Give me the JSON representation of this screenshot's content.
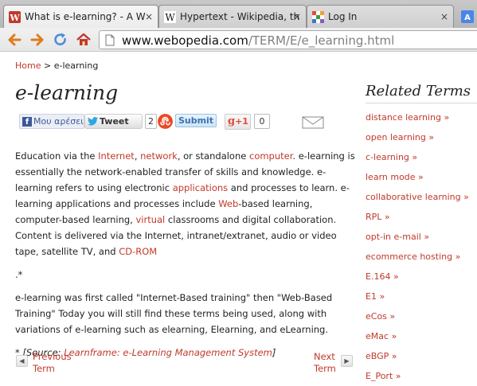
{
  "browser": {
    "tabs": [
      {
        "title": "What is e-learning? - A W",
        "icon": "webopedia-favicon",
        "active": true
      },
      {
        "title": "Hypertext - Wikipedia, th",
        "icon": "wikipedia-favicon",
        "active": false
      },
      {
        "title": "Log In",
        "icon": "login-favicon",
        "active": false
      }
    ],
    "close_glyph": "×",
    "url_host": "www.webopedia.com",
    "url_path": "/TERM/E/e_learning.html"
  },
  "breadcrumb": {
    "home": "Home",
    "separator": " > ",
    "current": "e-learning"
  },
  "page_title": "e-learning",
  "social": {
    "facebook_label": "Μου αρέσει",
    "tweet_label": "Tweet",
    "tweet_count": "2",
    "stumble_label": "Submit",
    "gplus_label": "+1",
    "gplus_count": "0"
  },
  "article": {
    "p1": [
      {
        "t": "Education via the "
      },
      {
        "t": "Internet",
        "link": true
      },
      {
        "t": ", "
      },
      {
        "t": "network",
        "link": true
      },
      {
        "t": ", or standalone "
      },
      {
        "t": "computer",
        "link": true
      },
      {
        "t": ". e-learning is essentially the network-enabled transfer of skills and knowledge. e-learning refers to using electronic "
      },
      {
        "t": "applications",
        "link": true
      },
      {
        "t": " and processes to learn. e-learning applications and processes include "
      },
      {
        "t": "Web",
        "link": true
      },
      {
        "t": "-based learning, computer-based learning, "
      },
      {
        "t": "virtual",
        "link": true
      },
      {
        "t": " classrooms and digital collaboration. Content is delivered via the Internet, intranet/extranet, audio or video tape, satellite TV, and "
      },
      {
        "t": "CD-ROM",
        "link": true
      }
    ],
    "p2": ".*",
    "p3": "e-learning was first called \"Internet-Based training\" then \"Web-Based Training\" Today you will still find these terms being used, along with variations of e-learning such as elearning, Elearning, and eLearning.",
    "source_prefix": "* [Source: ",
    "source_link": "Learnframe: e-Learning Management System",
    "source_suffix": "]"
  },
  "pager": {
    "prev_line1": "Previous",
    "prev_line2": "Term",
    "next_line1": "Next",
    "next_line2": "Term",
    "prev_arrow": "◀",
    "next_arrow": "▶"
  },
  "sidebar": {
    "title": "Related Terms",
    "items": [
      "distance learning »",
      "open learning »",
      "c-learning »",
      "learn mode »",
      "collaborative learning »",
      "RPL »",
      "opt-in e-mail »",
      "ecommerce hosting »",
      "E.164 »",
      "E1 »",
      "eCos »",
      "eMac »",
      "eBGP »",
      "E_Port »"
    ]
  },
  "colors": {
    "link": "#c0392b",
    "text": "#222222"
  }
}
